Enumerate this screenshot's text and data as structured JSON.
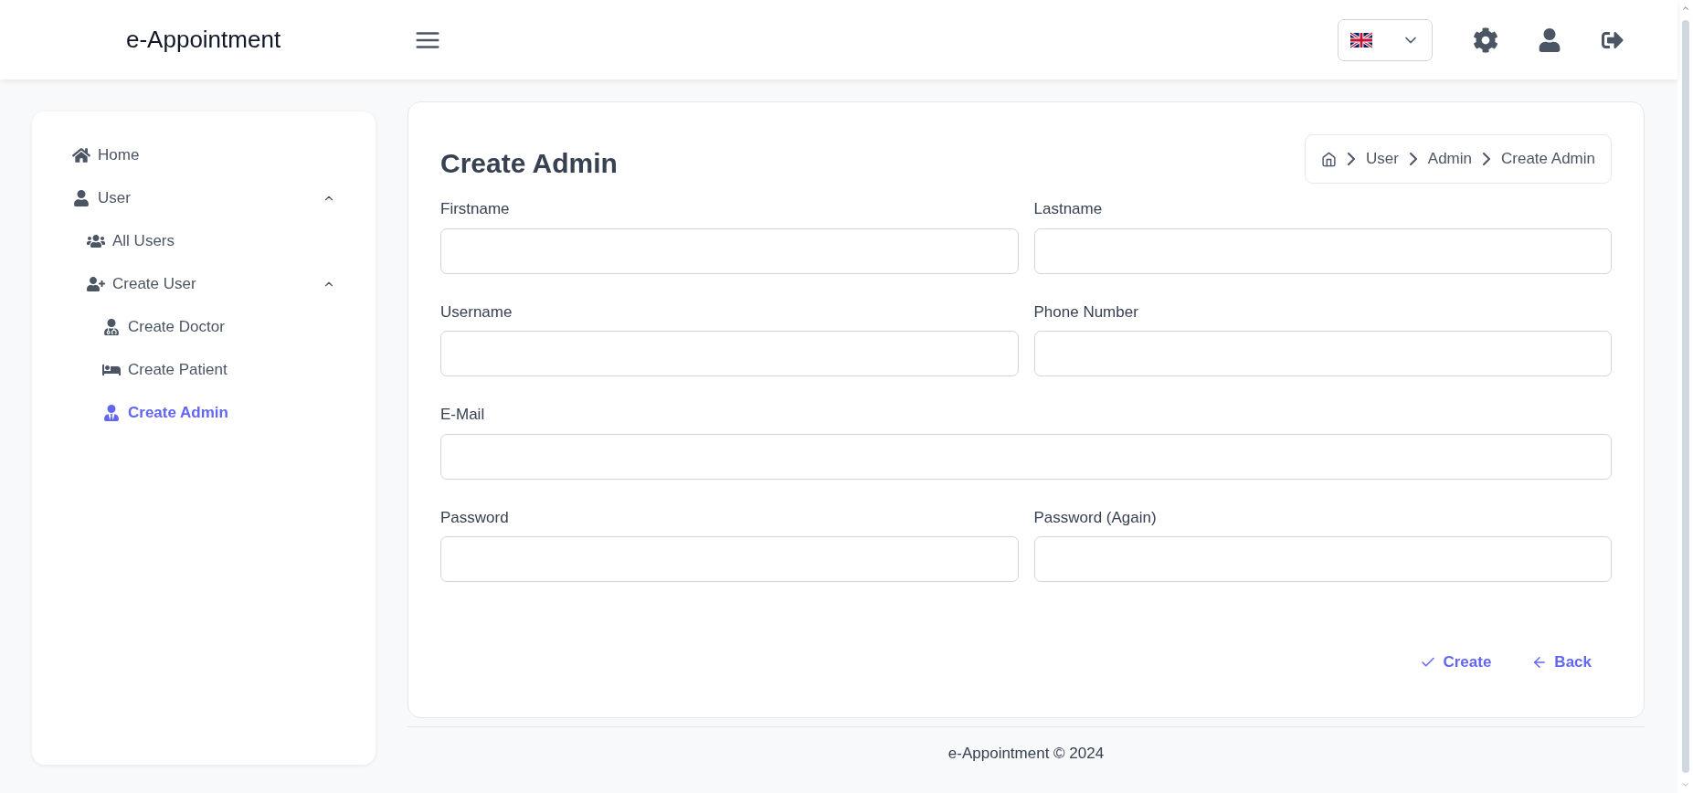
{
  "header": {
    "brand": "e-Appointment"
  },
  "sidebar": {
    "items": [
      {
        "label": "Home",
        "selected": false
      },
      {
        "label": "User",
        "expanded": true,
        "selected": false,
        "children": [
          {
            "label": "All Users",
            "selected": false
          },
          {
            "label": "Create User",
            "expanded": true,
            "selected": false,
            "children": [
              {
                "label": "Create Doctor",
                "selected": false
              },
              {
                "label": "Create Patient",
                "selected": false
              },
              {
                "label": "Create Admin",
                "selected": true
              }
            ]
          }
        ]
      }
    ]
  },
  "page": {
    "title": "Create Admin",
    "breadcrumb": [
      "User",
      "Admin",
      "Create Admin"
    ]
  },
  "form": {
    "rows": [
      [
        {
          "label": "Firstname"
        },
        {
          "label": "Lastname"
        }
      ],
      [
        {
          "label": "Username"
        },
        {
          "label": "Phone Number"
        }
      ],
      [
        {
          "label": "E-Mail"
        }
      ],
      [
        {
          "label": "Password"
        },
        {
          "label": "Password (Again)"
        }
      ]
    ],
    "buttons": [
      {
        "kind": "submit",
        "label": "Create"
      },
      {
        "kind": "back",
        "label": "Back"
      }
    ]
  },
  "footer": {
    "text": "e-Appointment © 2024"
  }
}
